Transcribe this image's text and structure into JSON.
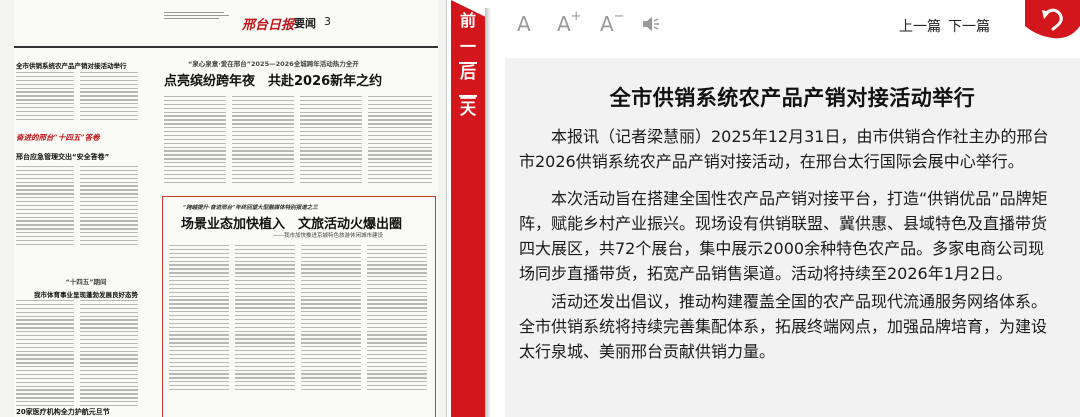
{
  "newspaper": {
    "paper_name": "邢台日报",
    "section": "要闻",
    "page_no": "3",
    "left_headline": "全市供销系统农产品产销对接活动举行",
    "banner_kicker": "“泉心泉意·爱在邢台”2025—2026全城跨年活动热力全开",
    "banner_headline": "点亮缤纷跨年夜　共赴2026新年之约",
    "column_tag": "奋进的邢台“十四五”答卷",
    "story2_headline": "邢台应急管理交出“安全答卷”",
    "story3_kicker": "“十四五”期间",
    "story3_headline": "我市体育事业呈现蓬勃发展良好态势",
    "box_kicker": "“跨越提升·奋进邢台”年终回望大型融媒体特别报道之三",
    "box_headline": "场景业态加快植入　文旅活动火爆出圈",
    "box_subhead": "——我市加快推进京城特色旅游休闲城市建设",
    "bottom_headline": "20家医疗机构全力护航元旦节"
  },
  "day_nav": {
    "prev_day": [
      "前",
      "一",
      "天"
    ],
    "next_day": [
      "后",
      "一",
      "天"
    ]
  },
  "toolbar": {
    "font_default": "A",
    "font_larger": "A",
    "font_larger_sign": "+",
    "font_smaller": "A",
    "font_smaller_sign": "−",
    "prev_article": "上一篇",
    "next_article": "下一篇"
  },
  "article": {
    "title": "全市供销系统农产品产销对接活动举行",
    "paragraphs": [
      "本报讯（记者梁慧丽）2025年12月31日，由市供销合作社主办的邢台市2026供销系统农产品产销对接活动，在邢台太行国际会展中心举行。",
      "本次活动旨在搭建全国性农产品产销对接平台，打造“供销优品”品牌矩阵，赋能乡村产业振兴。现场设有供销联盟、冀供惠、县域特色及直播带货四大展区，共72个展台，集中展示2000余种特色农产品。多家电商公司现场同步直播带货，拓宽产品销售渠道。活动将持续至2026年1月2日。",
      "活动还发出倡议，推动构建覆盖全国的农产品现代流通服务网络体系。全市供销系统将持续完善集配体系，拓展终端网点，加强品牌培育，为建设太行泉城、美丽邢台贡献供销力量。"
    ]
  },
  "colors": {
    "accent_red": "#d3161c",
    "article_bg": "#f2f2f2",
    "tool_grey": "#9a9a9a"
  }
}
